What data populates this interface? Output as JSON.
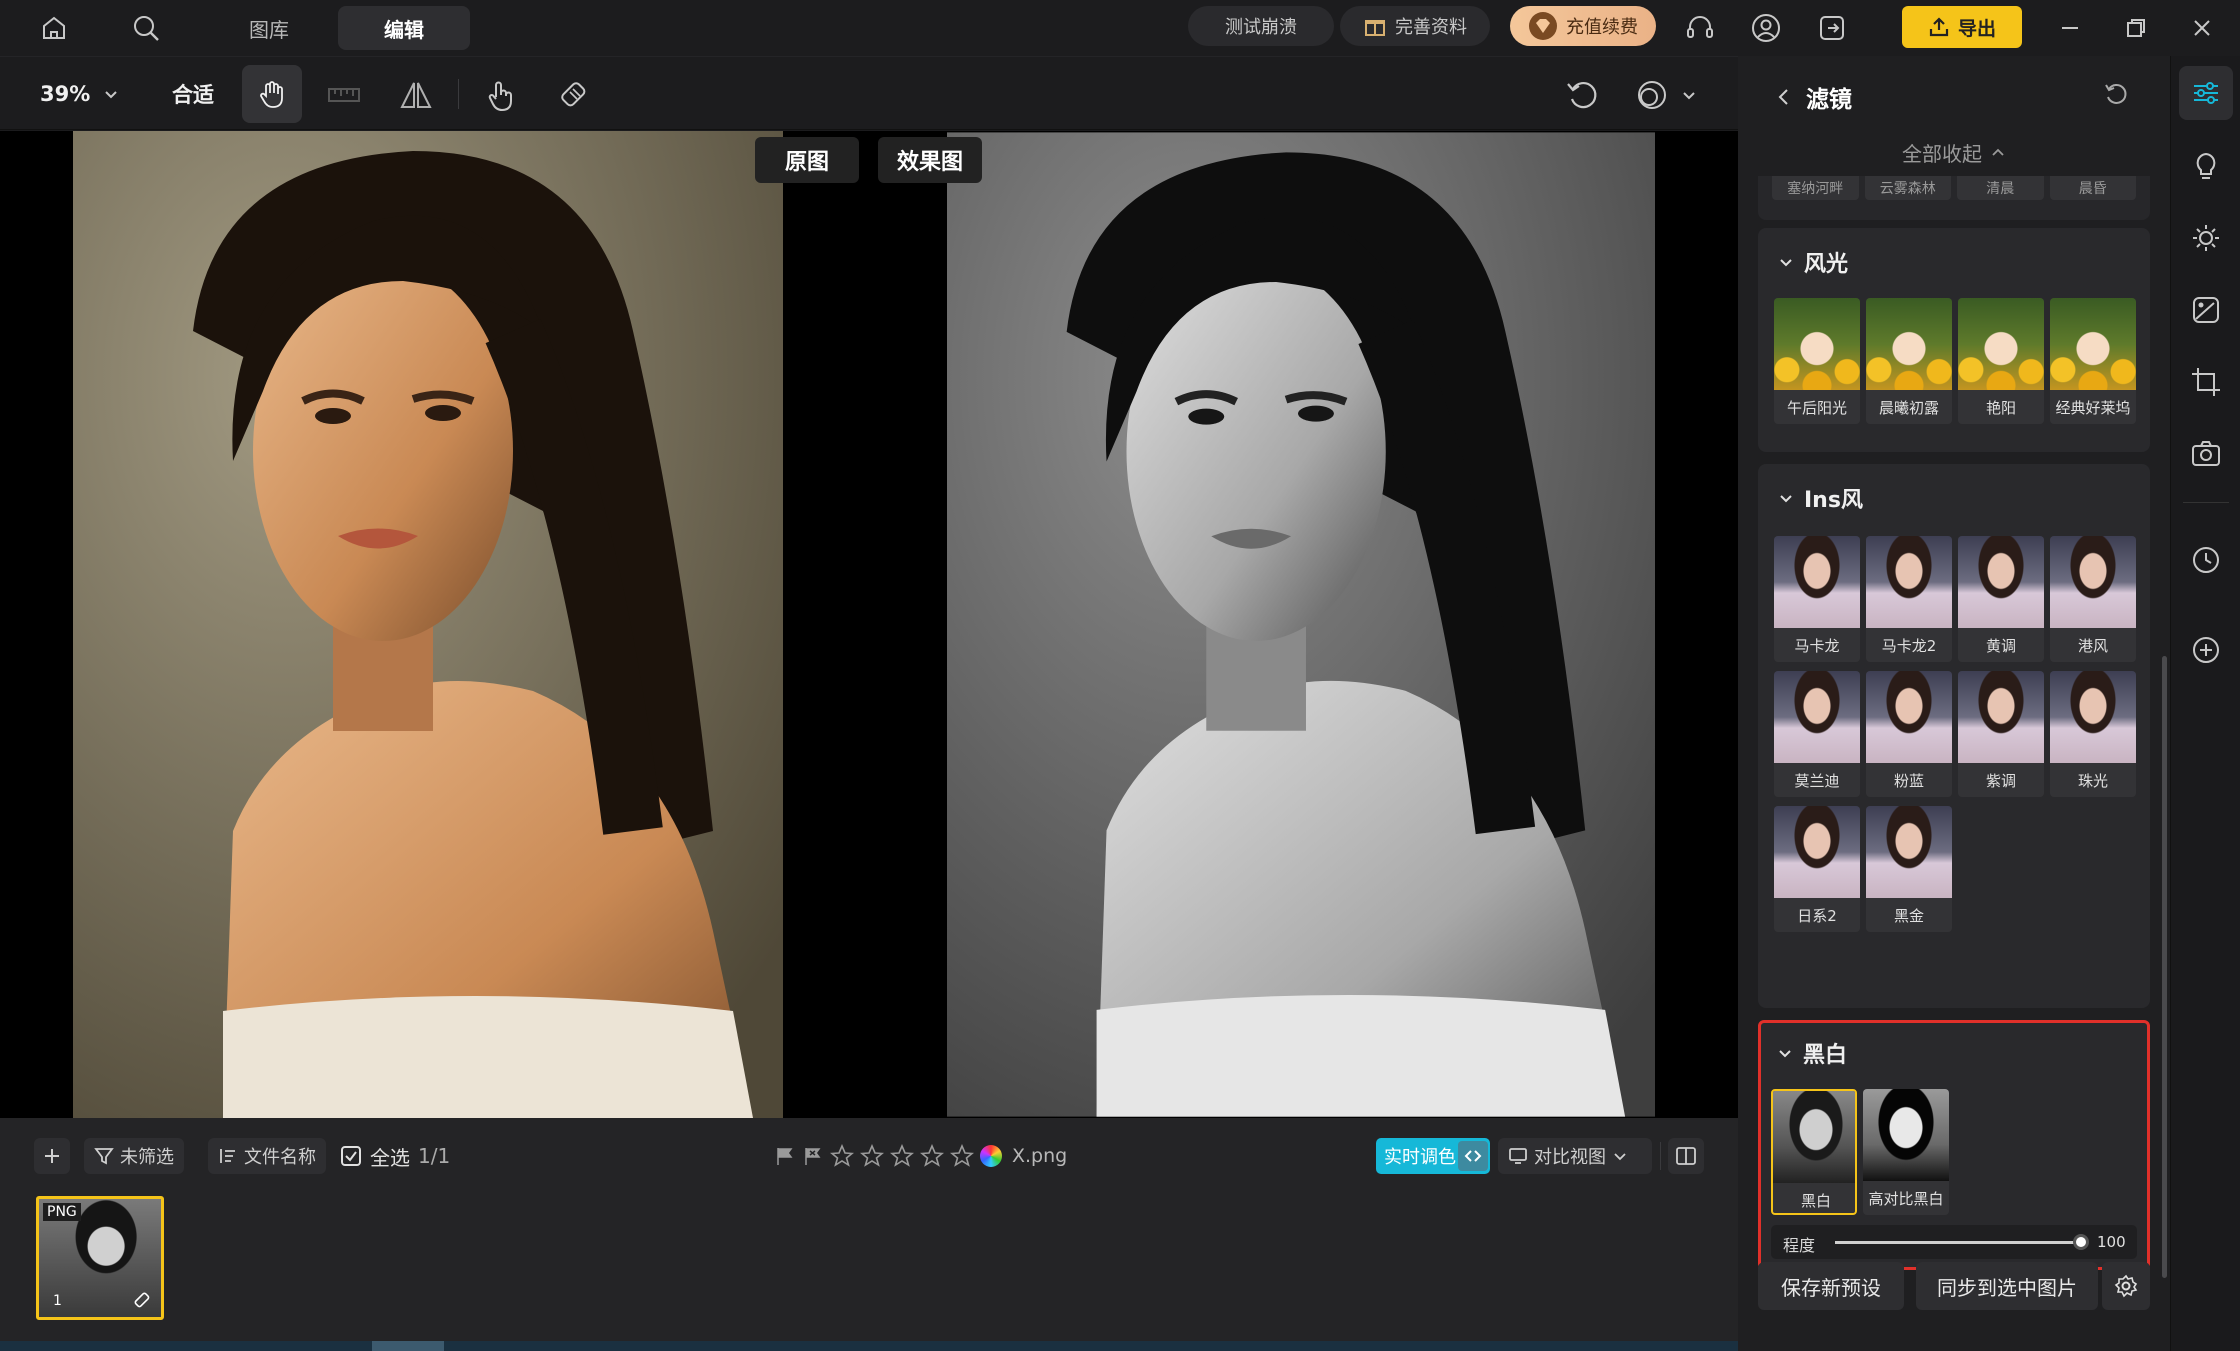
{
  "topbar": {
    "tabs": [
      "图库",
      "编辑"
    ],
    "active_tab": "编辑",
    "pill_test": "测试崩溃",
    "pill_profile": "完善资料",
    "pill_recharge": "充值续费",
    "export_label": "导出",
    "icons": [
      "home-icon",
      "search-icon",
      "headset-icon",
      "user-icon",
      "exit-icon",
      "minimize-icon",
      "restore-icon",
      "close-icon"
    ]
  },
  "toolbar": {
    "zoom": "39%",
    "fit_label": "合适",
    "tools": [
      "hand-tool-icon",
      "ruler-icon",
      "flip-icon",
      "touch-icon",
      "eraser-icon",
      "undo-icon",
      "overlay-icon"
    ]
  },
  "canvas": {
    "original_label": "原图",
    "effect_label": "效果图"
  },
  "bottombar": {
    "filter_label": "未筛选",
    "sort_label": "文件名称",
    "select_all_label": "全选",
    "select_count": "1/1",
    "file_name": "X.png",
    "stars": 0,
    "realtime_label": "实时调色",
    "compare_view_label": "对比视图",
    "thumb_format": "PNG",
    "thumb_index": "1"
  },
  "panel": {
    "title": "滤镜",
    "collapse_all": "全部收起",
    "partial_labels": [
      "塞纳河畔",
      "云雾森林",
      "清晨",
      "晨昏"
    ],
    "sections": [
      {
        "title": "风光",
        "items": [
          "午后阳光",
          "晨曦初露",
          "艳阳",
          "经典好莱坞"
        ]
      },
      {
        "title": "Ins风",
        "items": [
          "马卡龙",
          "马卡龙2",
          "黄调",
          "港风",
          "莫兰迪",
          "粉蓝",
          "紫调",
          "珠光",
          "日系2",
          "黑金"
        ]
      },
      {
        "title": "黑白",
        "items": [
          "黑白",
          "高对比黑白"
        ],
        "selected": "黑白"
      }
    ],
    "intensity_label": "程度",
    "intensity_value": "100",
    "intensity": 1.0,
    "save_preset": "保存新预设",
    "sync_label": "同步到选中图片"
  },
  "rail": {
    "icons": [
      "adjust-sliders-icon",
      "lightbulb-icon",
      "sun-icon",
      "image-edit-icon",
      "crop-icon",
      "camera-icon",
      "history-icon",
      "add-icon"
    ]
  },
  "colors": {
    "accent_yellow": "#f5c419",
    "highlight_red": "#e0302a",
    "realtime_cyan": "#16b8d8"
  }
}
